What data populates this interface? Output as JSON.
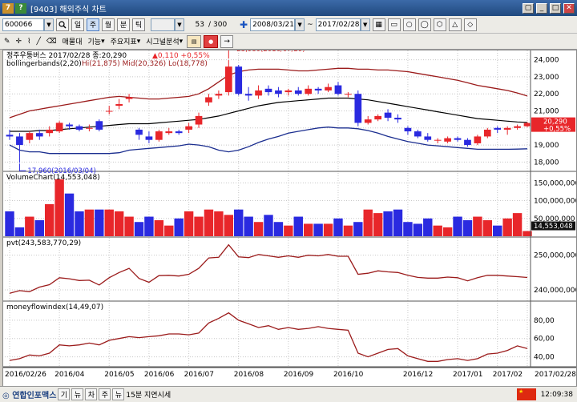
{
  "window": {
    "title": "[9403] 해외주식 차트",
    "icon_text": "?",
    "buttons": [
      "▢",
      "_",
      "□",
      "✕"
    ]
  },
  "toolbar": {
    "code": "600066",
    "period_buttons": [
      "일",
      "주",
      "월",
      "분",
      "틱"
    ],
    "selected_period": "주",
    "interval": "",
    "count_current": "53",
    "count_sep": "/",
    "count_total": "300",
    "date_from": "2008/03/21",
    "date_to": "2017/02/28",
    "date_sep": "~",
    "menu": [
      "매물대",
      "기능",
      "주요지표",
      "시그널분석"
    ],
    "draw_tools": [
      "→",
      "▭",
      "○",
      "◯",
      "⬡",
      "△",
      "◇"
    ]
  },
  "chart": {
    "stock_name": "정주우퉁버스",
    "header_date": "2017/02/28",
    "header_close_label": "종:20,290",
    "header_change": "▲0,110",
    "header_pct": "+0,55%",
    "bb_label": "bollingerbands(2,20)",
    "bb_values": "Hi(21,875)  Mid(20,326)  Lo(18,778)",
    "high_marker": "23,980(2016/07/29)",
    "low_marker": "17,960(2016/03/04)",
    "price_ticks": [
      "24,000",
      "23,000",
      "22,000",
      "21,000",
      "20,000",
      "19,000",
      "18,000"
    ],
    "price_flag_value": "20,290",
    "price_flag_pct": "+0,55%",
    "volume_label": "VolumeChart(14,553,048)",
    "volume_ticks": [
      "150,000,000",
      "100,000,000",
      "50,000,000"
    ],
    "volume_flag": "14,553,048",
    "pvt_label": "pvt(243,583,770,29)",
    "pvt_ticks": [
      "250,000,000",
      "240,000,000"
    ],
    "mfi_label": "moneyflowindex(14,49,07)",
    "mfi_ticks": [
      "80,00",
      "60,00",
      "40,00"
    ],
    "x_labels": [
      "2016/02/26",
      "2016/04",
      "2016/05",
      "2016/06",
      "2016/07",
      "2016/08",
      "2016/09",
      "2016/10",
      "2016/12",
      "2017/01",
      "2017/02",
      "2017/02/28"
    ],
    "colors": {
      "up": "#e8262a",
      "down": "#2a2ae0",
      "upper_band": "#9b1b1b",
      "mid_band": "#000000",
      "lower_band": "#1a2d8f",
      "indicator": "#9b1b1b"
    }
  },
  "chart_data": {
    "type": "candlestick",
    "x": [
      "2016/02/26",
      "2016/03/04",
      "2016/03/11",
      "2016/03/18",
      "2016/03/25",
      "2016/04/01",
      "2016/04/08",
      "2016/04/15",
      "2016/04/22",
      "2016/04/29",
      "2016/05/06",
      "2016/05/13",
      "2016/05/20",
      "2016/05/27",
      "2016/06/03",
      "2016/06/10",
      "2016/06/17",
      "2016/06/24",
      "2016/07/01",
      "2016/07/08",
      "2016/07/15",
      "2016/07/22",
      "2016/07/29",
      "2016/08/05",
      "2016/08/12",
      "2016/08/19",
      "2016/08/26",
      "2016/09/02",
      "2016/09/09",
      "2016/09/16",
      "2016/09/23",
      "2016/09/30",
      "2016/10/07",
      "2016/10/14",
      "2016/10/21",
      "2016/10/28",
      "2016/11/04",
      "2016/11/11",
      "2016/11/18",
      "2016/11/25",
      "2016/12/02",
      "2016/12/09",
      "2016/12/16",
      "2016/12/23",
      "2016/12/30",
      "2017/01/06",
      "2017/01/13",
      "2017/01/20",
      "2017/01/27",
      "2017/02/03",
      "2017/02/10",
      "2017/02/17",
      "2017/02/28"
    ],
    "open": [
      19600,
      19500,
      19300,
      19700,
      19700,
      19800,
      20200,
      20100,
      20000,
      20400,
      21000,
      21300,
      21700,
      19900,
      19500,
      19300,
      19700,
      19800,
      19900,
      20200,
      21500,
      21900,
      22100,
      23600,
      22000,
      21900,
      22300,
      22200,
      22100,
      22200,
      22000,
      22300,
      22200,
      22500,
      22000,
      22000,
      20300,
      20500,
      20900,
      20600,
      20000,
      19800,
      19500,
      19300,
      19200,
      19400,
      19300,
      19100,
      19500,
      20000,
      19900,
      20000,
      20100
    ],
    "close": [
      19500,
      19000,
      19700,
      19500,
      19900,
      20300,
      20100,
      19900,
      20000,
      19900,
      21000,
      21400,
      21800,
      19600,
      19300,
      19800,
      19800,
      19700,
      20100,
      20700,
      21800,
      22000,
      23600,
      22000,
      21900,
      22200,
      22100,
      22000,
      22200,
      22000,
      22300,
      22200,
      22400,
      22000,
      22000,
      20300,
      20500,
      20700,
      20600,
      20500,
      19800,
      19500,
      19300,
      19300,
      19400,
      19300,
      19000,
      19500,
      19900,
      19900,
      20000,
      20100,
      20290
    ],
    "high": [
      19900,
      19700,
      19800,
      19900,
      20100,
      20400,
      20300,
      20200,
      20200,
      20500,
      21300,
      21700,
      22000,
      20000,
      19800,
      19900,
      20000,
      19900,
      20300,
      20900,
      22000,
      22200,
      23980,
      23700,
      22400,
      22500,
      22500,
      22400,
      22300,
      22400,
      22500,
      22400,
      22600,
      22700,
      22100,
      22200,
      20700,
      20800,
      21100,
      20800,
      20100,
      19900,
      19700,
      19400,
      19500,
      19500,
      19400,
      19600,
      20000,
      20100,
      20100,
      20200,
      20350
    ],
    "low": [
      19300,
      17960,
      19100,
      19300,
      19500,
      19700,
      19900,
      19800,
      19800,
      19800,
      20800,
      21100,
      21500,
      19300,
      19100,
      19200,
      19600,
      19600,
      19700,
      20000,
      21300,
      21700,
      21900,
      21900,
      21600,
      21700,
      21900,
      21800,
      21900,
      21900,
      21900,
      22000,
      22100,
      21900,
      21800,
      20100,
      20200,
      20400,
      20400,
      20300,
      19600,
      19400,
      19200,
      19100,
      19100,
      19200,
      18900,
      19000,
      19400,
      19700,
      19600,
      19900,
      20050
    ],
    "bollinger": {
      "upper": [
        20600,
        20800,
        21000,
        21100,
        21200,
        21300,
        21400,
        21500,
        21600,
        21700,
        21800,
        21850,
        21800,
        21750,
        21700,
        21700,
        21750,
        21800,
        21850,
        22000,
        22300,
        22700,
        23100,
        23300,
        23400,
        23450,
        23450,
        23450,
        23400,
        23350,
        23350,
        23400,
        23450,
        23500,
        23500,
        23450,
        23450,
        23400,
        23400,
        23350,
        23300,
        23200,
        23100,
        23000,
        22900,
        22800,
        22650,
        22500,
        22400,
        22300,
        22200,
        22050,
        21875
      ],
      "middle": [
        19800,
        19800,
        19800,
        19850,
        19850,
        19900,
        19950,
        20000,
        20050,
        20100,
        20150,
        20200,
        20250,
        20250,
        20250,
        20300,
        20350,
        20400,
        20450,
        20500,
        20600,
        20700,
        20850,
        21000,
        21150,
        21300,
        21400,
        21500,
        21550,
        21600,
        21650,
        21700,
        21750,
        21750,
        21750,
        21700,
        21650,
        21550,
        21450,
        21350,
        21250,
        21150,
        21050,
        20950,
        20850,
        20750,
        20650,
        20550,
        20500,
        20450,
        20400,
        20350,
        20326
      ],
      "lower": [
        19000,
        18700,
        18600,
        18600,
        18500,
        18500,
        18500,
        18500,
        18500,
        18500,
        18500,
        18550,
        18700,
        18750,
        18800,
        18850,
        18900,
        18950,
        19050,
        19000,
        18900,
        18700,
        18600,
        18700,
        18900,
        19150,
        19350,
        19500,
        19700,
        19800,
        19900,
        20000,
        20050,
        20000,
        20000,
        19950,
        19850,
        19700,
        19500,
        19350,
        19200,
        19100,
        19000,
        18950,
        18900,
        18850,
        18800,
        18750,
        18750,
        18750,
        18750,
        18760,
        18778
      ]
    },
    "volume": [
      70000000,
      25000000,
      55000000,
      45000000,
      90000000,
      160000000,
      120000000,
      70000000,
      75000000,
      75000000,
      75000000,
      70000000,
      55000000,
      40000000,
      55000000,
      45000000,
      30000000,
      50000000,
      70000000,
      55000000,
      75000000,
      70000000,
      60000000,
      75000000,
      55000000,
      40000000,
      60000000,
      40000000,
      30000000,
      55000000,
      35000000,
      35000000,
      35000000,
      50000000,
      30000000,
      40000000,
      75000000,
      65000000,
      70000000,
      75000000,
      40000000,
      35000000,
      50000000,
      30000000,
      25000000,
      55000000,
      45000000,
      55000000,
      45000000,
      30000000,
      50000000,
      65000000,
      14553048
    ],
    "pvt": [
      239000000,
      239800000,
      239500000,
      240800000,
      241500000,
      243500000,
      243200000,
      242700000,
      242800000,
      241400000,
      243500000,
      245000000,
      246200000,
      243300000,
      242200000,
      244100000,
      244200000,
      244000000,
      244500000,
      246200000,
      249200000,
      249400000,
      253000000,
      249500000,
      249300000,
      250200000,
      249800000,
      249400000,
      249800000,
      249400000,
      250000000,
      249800000,
      250200000,
      249700000,
      249700000,
      244500000,
      244800000,
      245500000,
      245200000,
      245000000,
      244200000,
      243600000,
      243400000,
      243400000,
      243700000,
      243500000,
      242600000,
      243500000,
      244200000,
      244200000,
      244000000,
      243800000,
      243583770
    ],
    "mfi": [
      36,
      38,
      42,
      41,
      44,
      53,
      52,
      53,
      55,
      53,
      58,
      60,
      62,
      61,
      62,
      63,
      65,
      65,
      64,
      66,
      77,
      82,
      88,
      80,
      76,
      72,
      74,
      70,
      72,
      70,
      71,
      73,
      71,
      70,
      69,
      44,
      40,
      44,
      48,
      49,
      41,
      38,
      35,
      35,
      37,
      38,
      36,
      38,
      43,
      44,
      47,
      52,
      49.07
    ],
    "ylim_price": [
      17500,
      24500
    ],
    "ylim_volume": [
      0,
      180000000
    ],
    "ylim_pvt": [
      237000000,
      255000000
    ],
    "ylim_mfi": [
      30,
      100
    ]
  }
}
